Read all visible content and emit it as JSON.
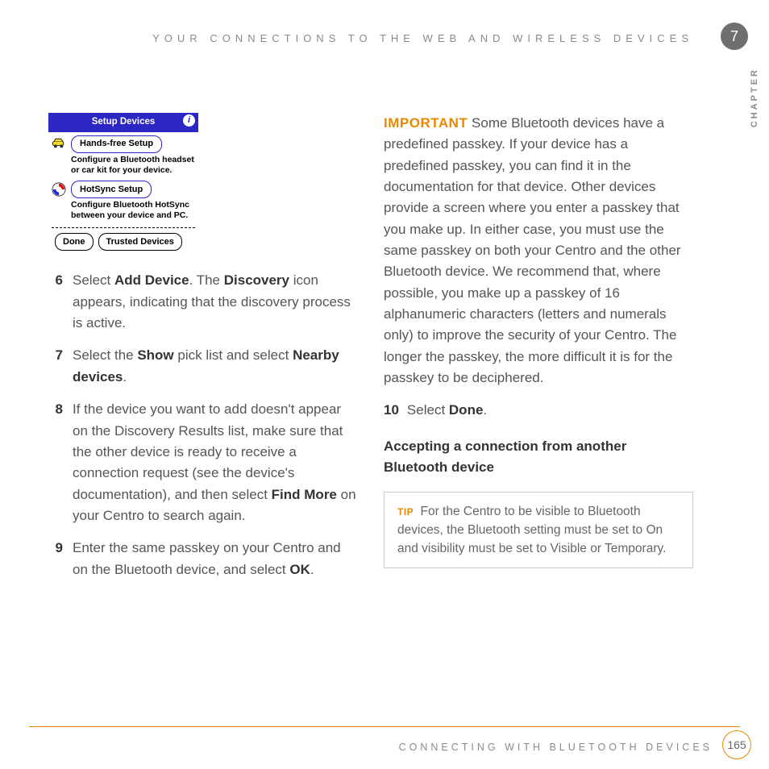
{
  "header": {
    "running_title": "YOUR CONNECTIONS TO THE WEB AND WIRELESS DEVICES",
    "chapter_number": "7",
    "chapter_label": "CHAPTER"
  },
  "palm_screenshot": {
    "title": "Setup Devices",
    "info_glyph": "i",
    "hands_free_button": "Hands-free Setup",
    "hands_free_desc": "Configure a Bluetooth headset or car kit for your device.",
    "hotsync_button": "HotSync Setup",
    "hotsync_desc": "Configure Bluetooth HotSync between your device and PC.",
    "done_button": "Done",
    "trusted_button": "Trusted Devices"
  },
  "steps": {
    "s6": {
      "num": "6",
      "pre": "Select ",
      "b1": "Add Device",
      "mid": ". The ",
      "b2": "Discovery",
      "post": " icon appears, indicating that the discovery process is active."
    },
    "s7": {
      "num": "7",
      "pre": "Select the ",
      "b1": "Show",
      "mid": " pick list and select ",
      "b2": "Nearby devices",
      "post": "."
    },
    "s8": {
      "num": "8",
      "pre": "If the device you want to add doesn't appear on the Discovery Results list, make sure that the other device is ready to receive a connection request (see the device's documentation), and then select ",
      "b1": "Find More",
      "post": " on your Centro to search again."
    },
    "s9": {
      "num": "9",
      "pre": "Enter the same passkey on your Centro and on the Bluetooth device, and select ",
      "b1": "OK",
      "post": "."
    }
  },
  "right": {
    "important_label": "IMPORTANT",
    "important_text": " Some Bluetooth devices have a predefined passkey. If your device has a predefined passkey, you can find it in the documentation for that device. Other devices provide a screen where you enter a passkey that you make up. In either case, you must use the same passkey on both your Centro and the other Bluetooth device. We recommend that, where possible, you make up a passkey of 16 alphanumeric characters (letters and numerals only) to improve the security of your Centro. The longer the passkey, the more difficult it is for the passkey to be deciphered.",
    "step10_num": "10",
    "step10_pre": "Select ",
    "step10_b": "Done",
    "step10_post": ".",
    "subhead": "Accepting a connection from another Bluetooth device",
    "tip_label": "TIP",
    "tip_text": " For the Centro to be visible to Bluetooth devices, the Bluetooth setting must be set to On and visibility must be set to Visible or Temporary."
  },
  "footer": {
    "section": "CONNECTING WITH BLUETOOTH DEVICES",
    "page": "165"
  }
}
